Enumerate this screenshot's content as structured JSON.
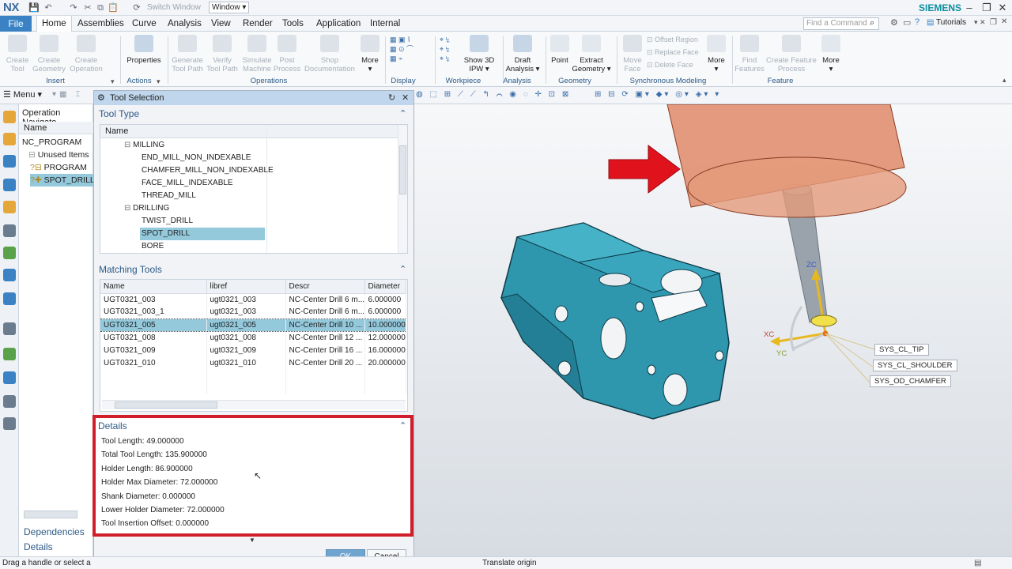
{
  "app": {
    "logo": "NX",
    "switch_window": "Switch Window",
    "window_menu": "Window ▾",
    "brand": "SIEMENS"
  },
  "menubar": {
    "file": "File",
    "tabs": [
      "Home",
      "Assemblies",
      "Curve",
      "Analysis",
      "View",
      "Render",
      "Tools",
      "Application",
      "Internal"
    ],
    "find_placeholder": "Find a Command",
    "tutorials": "Tutorials"
  },
  "ribbon": {
    "insert": {
      "buttons": [
        [
          "Create",
          "Tool"
        ],
        [
          "Create",
          "Geometry"
        ],
        [
          "Create",
          "Operation"
        ]
      ],
      "group": "Insert"
    },
    "actions": {
      "properties": "Properties",
      "group": "Actions"
    },
    "operations": {
      "buttons": [
        [
          "Generate",
          "Tool Path"
        ],
        [
          "Verify",
          "Tool Path"
        ],
        [
          "Simulate",
          "Machine"
        ],
        [
          "Post",
          "Process"
        ],
        [
          "Shop",
          "Documentation"
        ]
      ],
      "more": "More",
      "group": "Operations"
    },
    "display": {
      "group": "Display"
    },
    "workpiece": {
      "show3d": [
        "Show 3D",
        "IPW ▾"
      ],
      "group": "Workpiece"
    },
    "analysis": {
      "draft": [
        "Draft",
        "Analysis ▾"
      ],
      "group": "Analysis"
    },
    "geometry": {
      "point": "Point",
      "extract": [
        "Extract",
        "Geometry ▾"
      ],
      "group": "Geometry"
    },
    "sync": {
      "move_face": [
        "Move",
        "Face"
      ],
      "offset": "Offset Region",
      "replace": "Replace Face",
      "delete": "Delete Face",
      "more": "More",
      "group": "Synchronous Modeling"
    },
    "feature": {
      "find": [
        "Find",
        "Features"
      ],
      "create": [
        "Create Feature",
        "Process"
      ],
      "more": "More",
      "group": "Feature"
    }
  },
  "toolbar2": {
    "menu": "Menu ▾"
  },
  "navigator": {
    "title": "Operation Navigato",
    "col_name": "Name",
    "items": [
      "NC_PROGRAM",
      "Unused Items",
      "PROGRAM",
      "SPOT_DRILL"
    ],
    "dependencies": "Dependencies",
    "details": "Details"
  },
  "dialog": {
    "title": "Tool Selection",
    "tool_type": {
      "header": "Tool Type",
      "col": "Name",
      "items": [
        {
          "label": "MILLING",
          "level": 1
        },
        {
          "label": "END_MILL_NON_INDEXABLE",
          "level": 2
        },
        {
          "label": "CHAMFER_MILL_NON_INDEXABLE",
          "level": 2
        },
        {
          "label": "FACE_MILL_INDEXABLE",
          "level": 2
        },
        {
          "label": "THREAD_MILL",
          "level": 2
        },
        {
          "label": "DRILLING",
          "level": 1
        },
        {
          "label": "TWIST_DRILL",
          "level": 2
        },
        {
          "label": "SPOT_DRILL",
          "level": 2,
          "selected": true
        },
        {
          "label": "BORE",
          "level": 2
        }
      ]
    },
    "matching": {
      "header": "Matching Tools",
      "columns": [
        "Name",
        "libref",
        "Descr",
        "Diameter"
      ],
      "rows": [
        [
          "UGT0321_003",
          "ugt0321_003",
          "NC-Center Drill 6 m...",
          "6.000000"
        ],
        [
          "UGT0321_003_1",
          "ugt0321_003",
          "NC-Center Drill 6 m...",
          "6.000000"
        ],
        [
          "UGT0321_005",
          "ugt0321_005",
          "NC-Center Drill 10 ...",
          "10.000000"
        ],
        [
          "UGT0321_008",
          "ugt0321_008",
          "NC-Center Drill 12 ...",
          "12.000000"
        ],
        [
          "UGT0321_009",
          "ugt0321_009",
          "NC-Center Drill 16 ...",
          "16.000000"
        ],
        [
          "UGT0321_010",
          "ugt0321_010",
          "NC-Center Drill 20 ...",
          "20.000000"
        ]
      ],
      "selected_row": 2
    },
    "details": {
      "header": "Details",
      "lines": [
        "Tool Length: 49.000000",
        "Total Tool Length: 135.900000",
        "Holder Length: 86.900000",
        "Holder Max Diameter: 72.000000",
        "Shank Diameter: 0.000000",
        "Lower Holder Diameter: 72.000000",
        "Tool Insertion Offset: 0.000000"
      ]
    },
    "ok": "OK",
    "cancel": "Cancel"
  },
  "viewport": {
    "axes": {
      "zc": "ZC",
      "xc": "XC",
      "yc": "YC"
    },
    "labels": [
      "SYS_CL_TIP",
      "SYS_CL_SHOULDER",
      "SYS_OD_CHAMFER"
    ],
    "colors": {
      "part": "#2e97ae",
      "holder": "#df8a68",
      "arrow": "#e0131d"
    }
  },
  "status": {
    "left": "Drag a handle or select a",
    "center": "Translate origin"
  }
}
